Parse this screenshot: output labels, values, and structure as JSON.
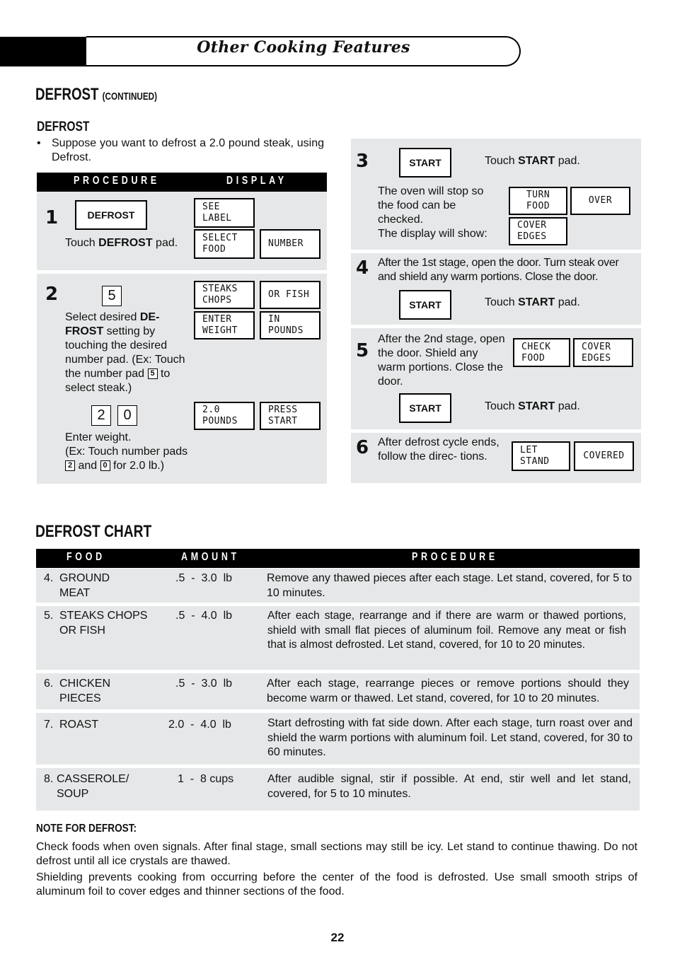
{
  "header": {
    "banner_title": "Other Cooking Features"
  },
  "section": {
    "title": "DEFROST",
    "title_suffix": "(CONTINUED)",
    "subtitle": "DEFROST",
    "bullet": "•",
    "intro": "Suppose you want to defrost a 2.0 pound steak, using Defrost."
  },
  "procedure_table": {
    "col_procedure": "PROCEDURE",
    "col_display": "DISPLAY",
    "steps": [
      {
        "number": "1",
        "pad": "DEFROST",
        "text_pre": "Touch ",
        "text_bold": "DEFROST",
        "text_post": " pad.",
        "displays": [
          [
            "SEE",
            "LABEL"
          ],
          [
            "SELECT",
            "FOOD"
          ],
          [
            "NUMBER"
          ]
        ]
      },
      {
        "number": "2",
        "key": "5",
        "text_a1": "Select desired ",
        "text_bold1": "DE-",
        "text_bold2": "FROST",
        "text_a2": " setting by touching the desired number pad. (Ex: Touch the number pad ",
        "text_a3": " to select steak.)",
        "keys2": [
          "2",
          "0"
        ],
        "text_b1": "Enter weight.",
        "text_b2": "(Ex: Touch number pads",
        "text_b3": " and ",
        "text_b4": " for 2.0 lb.)",
        "displays": [
          [
            "STEAKS",
            "CHOPS"
          ],
          [
            "OR FISH"
          ],
          [
            "ENTER",
            "WEIGHT"
          ],
          [
            "IN",
            "POUNDS"
          ],
          [
            "2.0",
            "POUNDS"
          ],
          [
            "PRESS",
            "START"
          ]
        ]
      },
      {
        "number": "3",
        "pad": "START",
        "text_pre": "Touch ",
        "text_bold": "START",
        "text_post": " pad.",
        "text2": "The oven will stop so the food can be checked.",
        "text3": "The display will show:",
        "displays": [
          [
            "TURN",
            "FOOD"
          ],
          [
            "OVER"
          ],
          [
            "COVER",
            "EDGES"
          ]
        ]
      },
      {
        "number": "4",
        "text": "After the 1st stage, open the door. Turn steak over and shield any warm portions. Close the door.",
        "pad": "START",
        "text_pre": "Touch ",
        "text_bold": "START",
        "text_post": " pad."
      },
      {
        "number": "5",
        "text": "After the 2nd stage, open the door. Shield any warm portions. Close the door.",
        "pad": "START",
        "text_pre": "Touch ",
        "text_bold": "START",
        "text_post": " pad.",
        "displays": [
          [
            "CHECK",
            "FOOD"
          ],
          [
            "COVER",
            "EDGES"
          ]
        ]
      },
      {
        "number": "6",
        "text": "After defrost cycle ends, follow the direc- tions.",
        "displays": [
          [
            "LET",
            "STAND"
          ],
          [
            "COVERED"
          ]
        ]
      }
    ]
  },
  "defrost_chart": {
    "title": "DEFROST CHART",
    "columns": [
      "FOOD",
      "AMOUNT",
      "PROCEDURE"
    ],
    "rows": [
      {
        "num": "4.",
        "food_line1": "GROUND",
        "food_line2": "MEAT",
        "amount": ".5  -  3.0  lb",
        "procedure": "Remove any thawed pieces after each stage. Let stand, covered, for 5 to 10 minutes."
      },
      {
        "num": "5.",
        "food_line1": "STEAKS CHOPS",
        "food_line2": "OR FISH",
        "amount": ".5  -  4.0  lb",
        "procedure": "After each stage, rearrange and if there are warm or thawed portions, shield with small flat pieces of aluminum foil. Remove any meat or fish that is almost defrosted. Let stand, covered, for 10 to 20 minutes."
      },
      {
        "num": "6.",
        "food_line1": "CHICKEN",
        "food_line2": "PIECES",
        "amount": ".5  -  3.0  lb",
        "procedure": "After each stage, rearrange pieces or remove portions should they become warm or thawed. Let stand, covered, for 10 to 20 minutes."
      },
      {
        "num": "7.",
        "food_line1": "ROAST",
        "food_line2": "",
        "amount": "2.0  -  4.0  lb",
        "procedure": "Start defrosting with fat side down. After each stage, turn roast over and shield the warm portions with aluminum foil. Let stand, covered, for 30 to 60 minutes."
      },
      {
        "num": "8.",
        "food_line1": "CASSEROLE/",
        "food_line2": "SOUP",
        "amount": "1  -  8 cups",
        "procedure": "After audible signal, stir if possible. At end, stir well and let stand, covered, for 5 to 10 minutes."
      }
    ]
  },
  "note": {
    "title": "NOTE FOR DEFROST:",
    "paragraphs": [
      "Check foods when oven signals. After final stage, small sections may still be icy. Let stand to continue thawing. Do not defrost until all ice crystals are thawed.",
      "Shielding prevents cooking from occurring before the center of the food is defrosted. Use small smooth strips of aluminum foil to cover edges and thinner sections of the food."
    ]
  },
  "page_number": "22"
}
